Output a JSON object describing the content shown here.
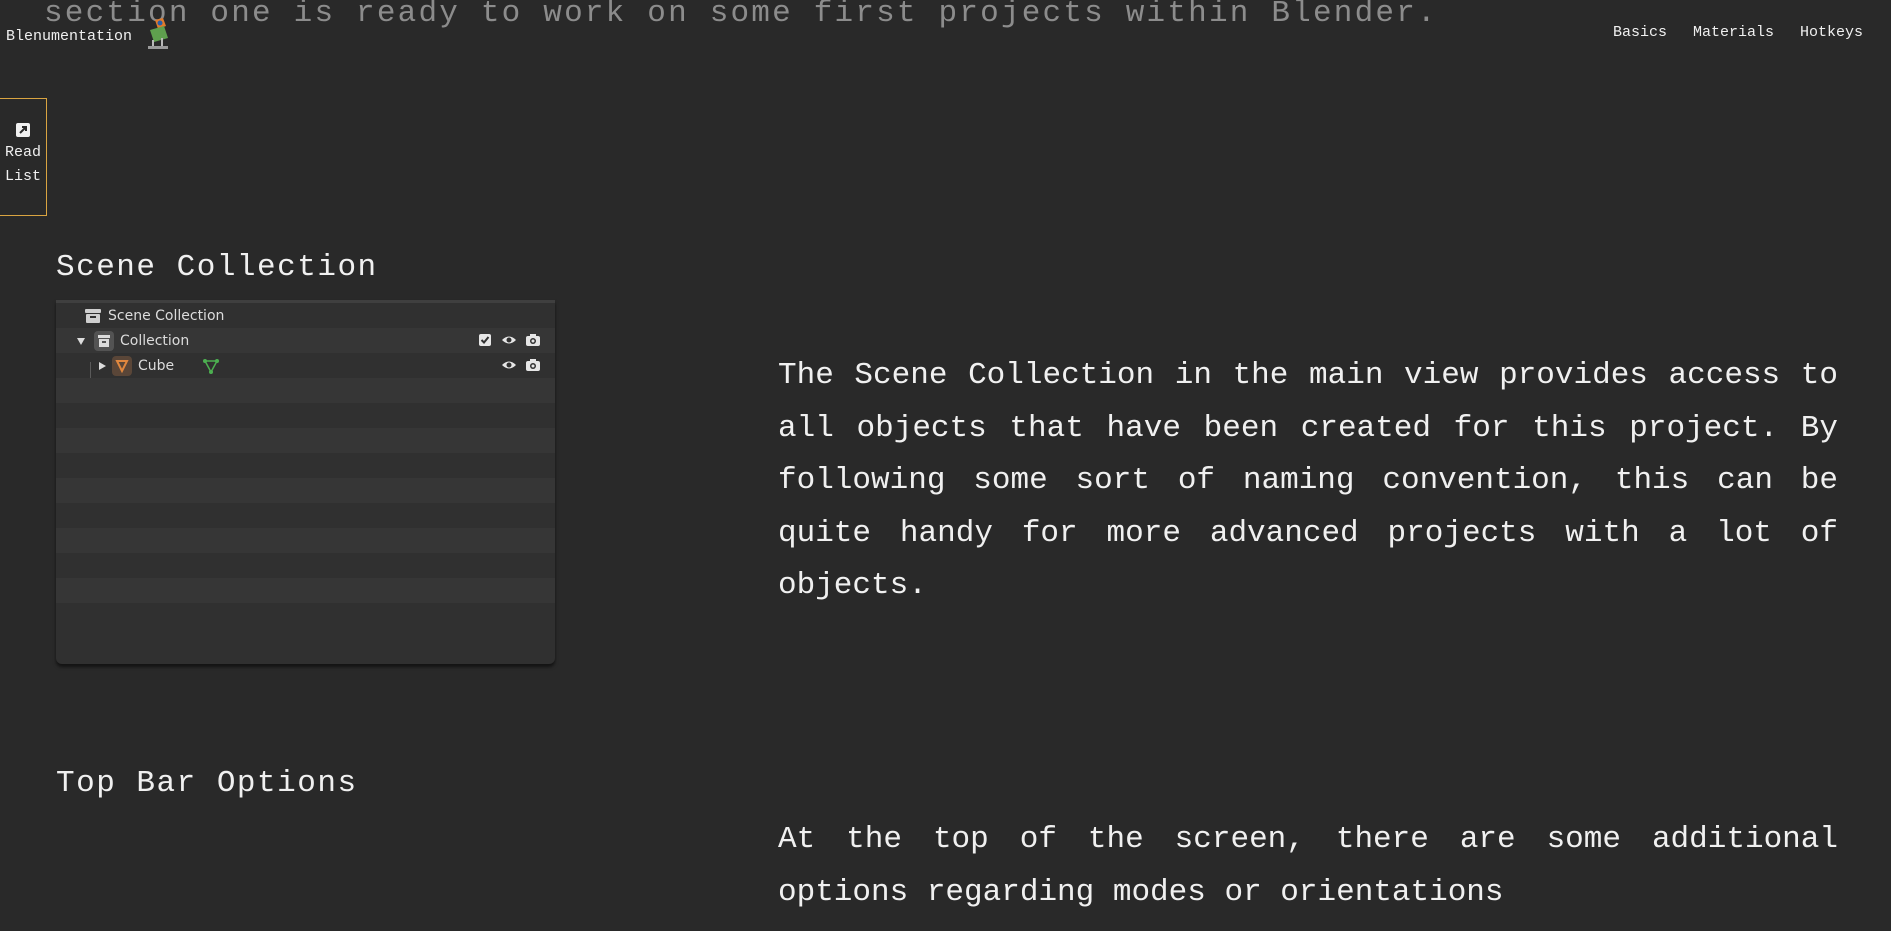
{
  "scrolled_text": "section one is ready to work on some first projects within Blender.",
  "brand": {
    "name": "Blenumentation"
  },
  "nav": {
    "items": [
      "Basics",
      "Materials",
      "Hotkeys"
    ]
  },
  "read_list": {
    "line1": "Read",
    "line2": "List"
  },
  "sections": {
    "scene_collection": {
      "title": "Scene Collection",
      "paragraph": "The Scene Collection in the main view provides access to all objects that have been created for this project. By following some sort of naming convention, this can be quite handy for more advanced projects with a lot of objects."
    },
    "top_bar": {
      "title": "Top Bar Options",
      "paragraph": "At the top of the screen, there are some additional options regarding modes or orientations"
    }
  },
  "outliner": {
    "root_label": "Scene Collection",
    "collection_label": "Collection",
    "object_label": "Cube"
  },
  "colors": {
    "background": "#292929",
    "accent_border": "#d9a441",
    "mesh_data_icon": "#4caf50",
    "object_icon": "#e0873e"
  }
}
